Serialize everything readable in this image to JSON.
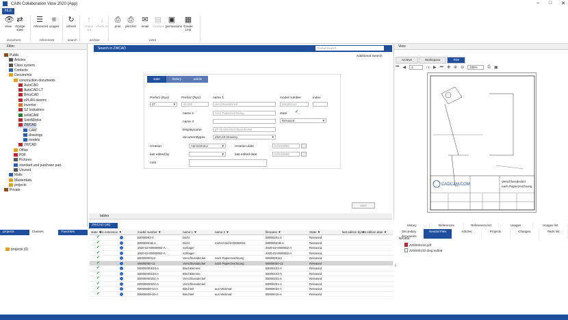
{
  "window": {
    "title": "CAIN Collaboration View 2020 (App)",
    "minimize": "–",
    "maximize": "□",
    "close": "✕"
  },
  "file_tab": "FILE",
  "ribbon": {
    "buttons": [
      {
        "label": "View",
        "icon": "eye-icon",
        "glyph": "👁",
        "enabled": true
      },
      {
        "label": "change state",
        "icon": "change-state-icon",
        "glyph": "⇄",
        "enabled": true
      },
      {
        "label": "references",
        "icon": "references-icon",
        "glyph": "☰",
        "enabled": true
      },
      {
        "label": "usages",
        "icon": "usages-icon",
        "glyph": "≡",
        "enabled": true
      },
      {
        "label": "refresh",
        "icon": "refresh-icon",
        "glyph": "↻",
        "enabled": true
      },
      {
        "label": "check out",
        "icon": "check-out-icon",
        "glyph": "↑",
        "enabled": false
      },
      {
        "label": "check in",
        "icon": "check-in-icon",
        "glyph": "↓",
        "enabled": false
      },
      {
        "label": "print",
        "icon": "printer-icon",
        "glyph": "⎙",
        "enabled": true
      },
      {
        "label": "print list",
        "icon": "print-list-icon",
        "glyph": "⎙",
        "enabled": true
      },
      {
        "label": "email",
        "icon": "email-icon",
        "glyph": "✉",
        "enabled": true
      },
      {
        "label": "location",
        "icon": "location-icon",
        "glyph": "▤",
        "enabled": false
      },
      {
        "label": "permissions",
        "icon": "permissions-icon",
        "glyph": "▣",
        "enabled": true
      },
      {
        "label": "Create Link",
        "icon": "link-icon",
        "glyph": "▦",
        "enabled": true
      }
    ],
    "groups": [
      "document",
      "references",
      "search",
      "archive",
      "extra"
    ]
  },
  "tree": {
    "header": "Filter",
    "items": [
      {
        "label": "Public",
        "depth": 0,
        "color": "#8a4d1a"
      },
      {
        "label": "Articles",
        "depth": 1,
        "color": "#555"
      },
      {
        "label": "Class system",
        "depth": 1,
        "color": "#555"
      },
      {
        "label": "Contacts",
        "depth": 1,
        "color": "#2b5fb0"
      },
      {
        "label": "Documents",
        "depth": 1,
        "color": "#e0a020"
      },
      {
        "label": "construction documents",
        "depth": 2,
        "color": "#e0a020"
      },
      {
        "label": "AutoCAD",
        "depth": 3,
        "color": "#c0262d"
      },
      {
        "label": "AutoCAD LT",
        "depth": 3,
        "color": "#c0262d"
      },
      {
        "label": "BricsCAD",
        "depth": 3,
        "color": "#c0262d"
      },
      {
        "label": "ePLAN electric",
        "depth": 3,
        "color": "#c0262d"
      },
      {
        "label": "Inventor",
        "depth": 3,
        "color": "#e07020"
      },
      {
        "label": "SZ Industries",
        "depth": 3,
        "color": "#c0262d"
      },
      {
        "label": "solidCAM",
        "depth": 3,
        "color": "#2e7d32"
      },
      {
        "label": "SolidWorks",
        "depth": 3,
        "color": "#c0262d"
      },
      {
        "label": "ZWCAD",
        "depth": 3,
        "color": "#c0262d",
        "selected": true
      },
      {
        "label": "CAM",
        "depth": 4,
        "color": "#2b5fb0"
      },
      {
        "label": "drawings",
        "depth": 4,
        "color": "#2b5fb0"
      },
      {
        "label": "models",
        "depth": 4,
        "color": "#2b5fb0"
      },
      {
        "label": "ZWCAD",
        "depth": 3,
        "color": "#c0262d"
      },
      {
        "label": "Office",
        "depth": 2,
        "color": "#e0a020"
      },
      {
        "label": "PDF",
        "depth": 2,
        "color": "#c0262d"
      },
      {
        "label": "Pictures",
        "depth": 2,
        "color": "#555"
      },
      {
        "label": "standard and purchase part",
        "depth": 2,
        "color": "#2b5fb0"
      },
      {
        "label": "Unused",
        "depth": 2,
        "color": "#555"
      },
      {
        "label": "Mails",
        "depth": 1,
        "color": "#2b5fb0"
      },
      {
        "label": "Masterdata",
        "depth": 1,
        "color": "#e0a020"
      },
      {
        "label": "projects",
        "depth": 1,
        "color": "#e0a020"
      },
      {
        "label": "Private",
        "depth": 0,
        "color": "#8a4d1a"
      }
    ],
    "bottom_tabs": [
      "projects",
      "Classes",
      "Favorites"
    ],
    "bottom_item": "projects (0)"
  },
  "search": {
    "title": "Search in ZWCAD",
    "placeholder": "Global Search",
    "additional": "Additional Search"
  },
  "form": {
    "tabs": [
      "state",
      "history",
      "article"
    ],
    "labels": {
      "prefix": "Prefix1 (Ryo)",
      "prefix2": "Prefix2 (Ryo)",
      "name1": "name 1",
      "model": "model number",
      "index": "index",
      "name2": "name 2",
      "name3": "name 3",
      "state": "state",
      "display": "Displayname",
      "doctype": "documenttypes",
      "creator": "creation",
      "cdate": "creation date",
      "editedby": "last edited by",
      "edate": "last edited date",
      "note": "note"
    },
    "values": {
      "prefix": "ZT",
      "prefix2": "00.000",
      "name1": "Verschlussdeckel",
      "model": "B00000112",
      "name2": "nach Papierzeichnung",
      "state": "Released",
      "display": "ZT-15.000-Verschlussdeckel",
      "doctype": "ZWCAD Drawing",
      "creator": "Administrator",
      "cdate": "02/03/2020",
      "edate": "02/03/2020"
    },
    "save": "save"
  },
  "preview": {
    "header": "View",
    "tabs": [
      "Archive",
      "Workspace",
      "PDF"
    ],
    "page": "1",
    "pages": "/ 1",
    "zoom": "100%",
    "title_block": [
      "Verschlussdeckel",
      "nach Papierzeichnung"
    ],
    "brand": "CADCAM.COM"
  },
  "tables": {
    "label": "tables",
    "tab": "ZWCAD (46)",
    "columns": [
      "state",
      "file extension",
      "model number",
      "name 1",
      "name 2",
      "filename",
      "State",
      "last edition by",
      "last edition date"
    ],
    "rows": [
      [
        "B0000002-A",
        "Dicht",
        "",
        "B0000201-A",
        "Released"
      ],
      [
        "B0000001B-A",
        "Dicht",
        "24ZH2-Dicht-00000021",
        "B0000021B-A",
        "Released"
      ],
      [
        "2020-02-00000002-A",
        "Schlager",
        "",
        "2020-02-0000002-A",
        "Released"
      ],
      [
        "2020-02-00000002-A",
        "Schlager",
        "",
        "2020-02-0000002-A",
        "Released"
      ],
      [
        "B0000000112",
        "Verschlussdeckel",
        "nach Papierzeichnung",
        "B000000112",
        "Released"
      ],
      [
        "B0000000-12",
        "Verschlussdeckel",
        "nach Papierzeichnung",
        "B0000000-12",
        "Released"
      ],
      [
        "B0000000103-A",
        "Blechklemme",
        "",
        "B0000103-A",
        "Released"
      ],
      [
        "B0000000103-A",
        "Blechklemme",
        "",
        "B0000103-A",
        "Released"
      ],
      [
        "B0000000201-A",
        "Verschlussdeckel",
        "",
        "B0000201-A",
        "Released"
      ],
      [
        "B0000000201-A",
        "Verschlussdeckel",
        "",
        "B0000201-A",
        "Released"
      ],
      [
        "B0000000-14-A",
        "Blechteil",
        "aus Wickmar",
        "B0000034-A",
        "Released"
      ],
      [
        "B0000000-16-A",
        "Blechteil",
        "aus Wickmar",
        "B0000016-A",
        "Released"
      ]
    ]
  },
  "details": {
    "tabs_top": [
      "History",
      "References",
      "References list",
      "Usages",
      "Usages list"
    ],
    "tabs_bottom": [
      "Secondary documents",
      "Neutral Files",
      "Articles",
      "Projects",
      "Changes",
      "Parts list"
    ],
    "tree_root": "Neutral",
    "files": [
      "ZZ0000112.pdf",
      "ZZ0000112.dwg.wdbat"
    ]
  },
  "colors": {
    "accent": "#1f4e9c",
    "check": "#2a9a3a"
  }
}
